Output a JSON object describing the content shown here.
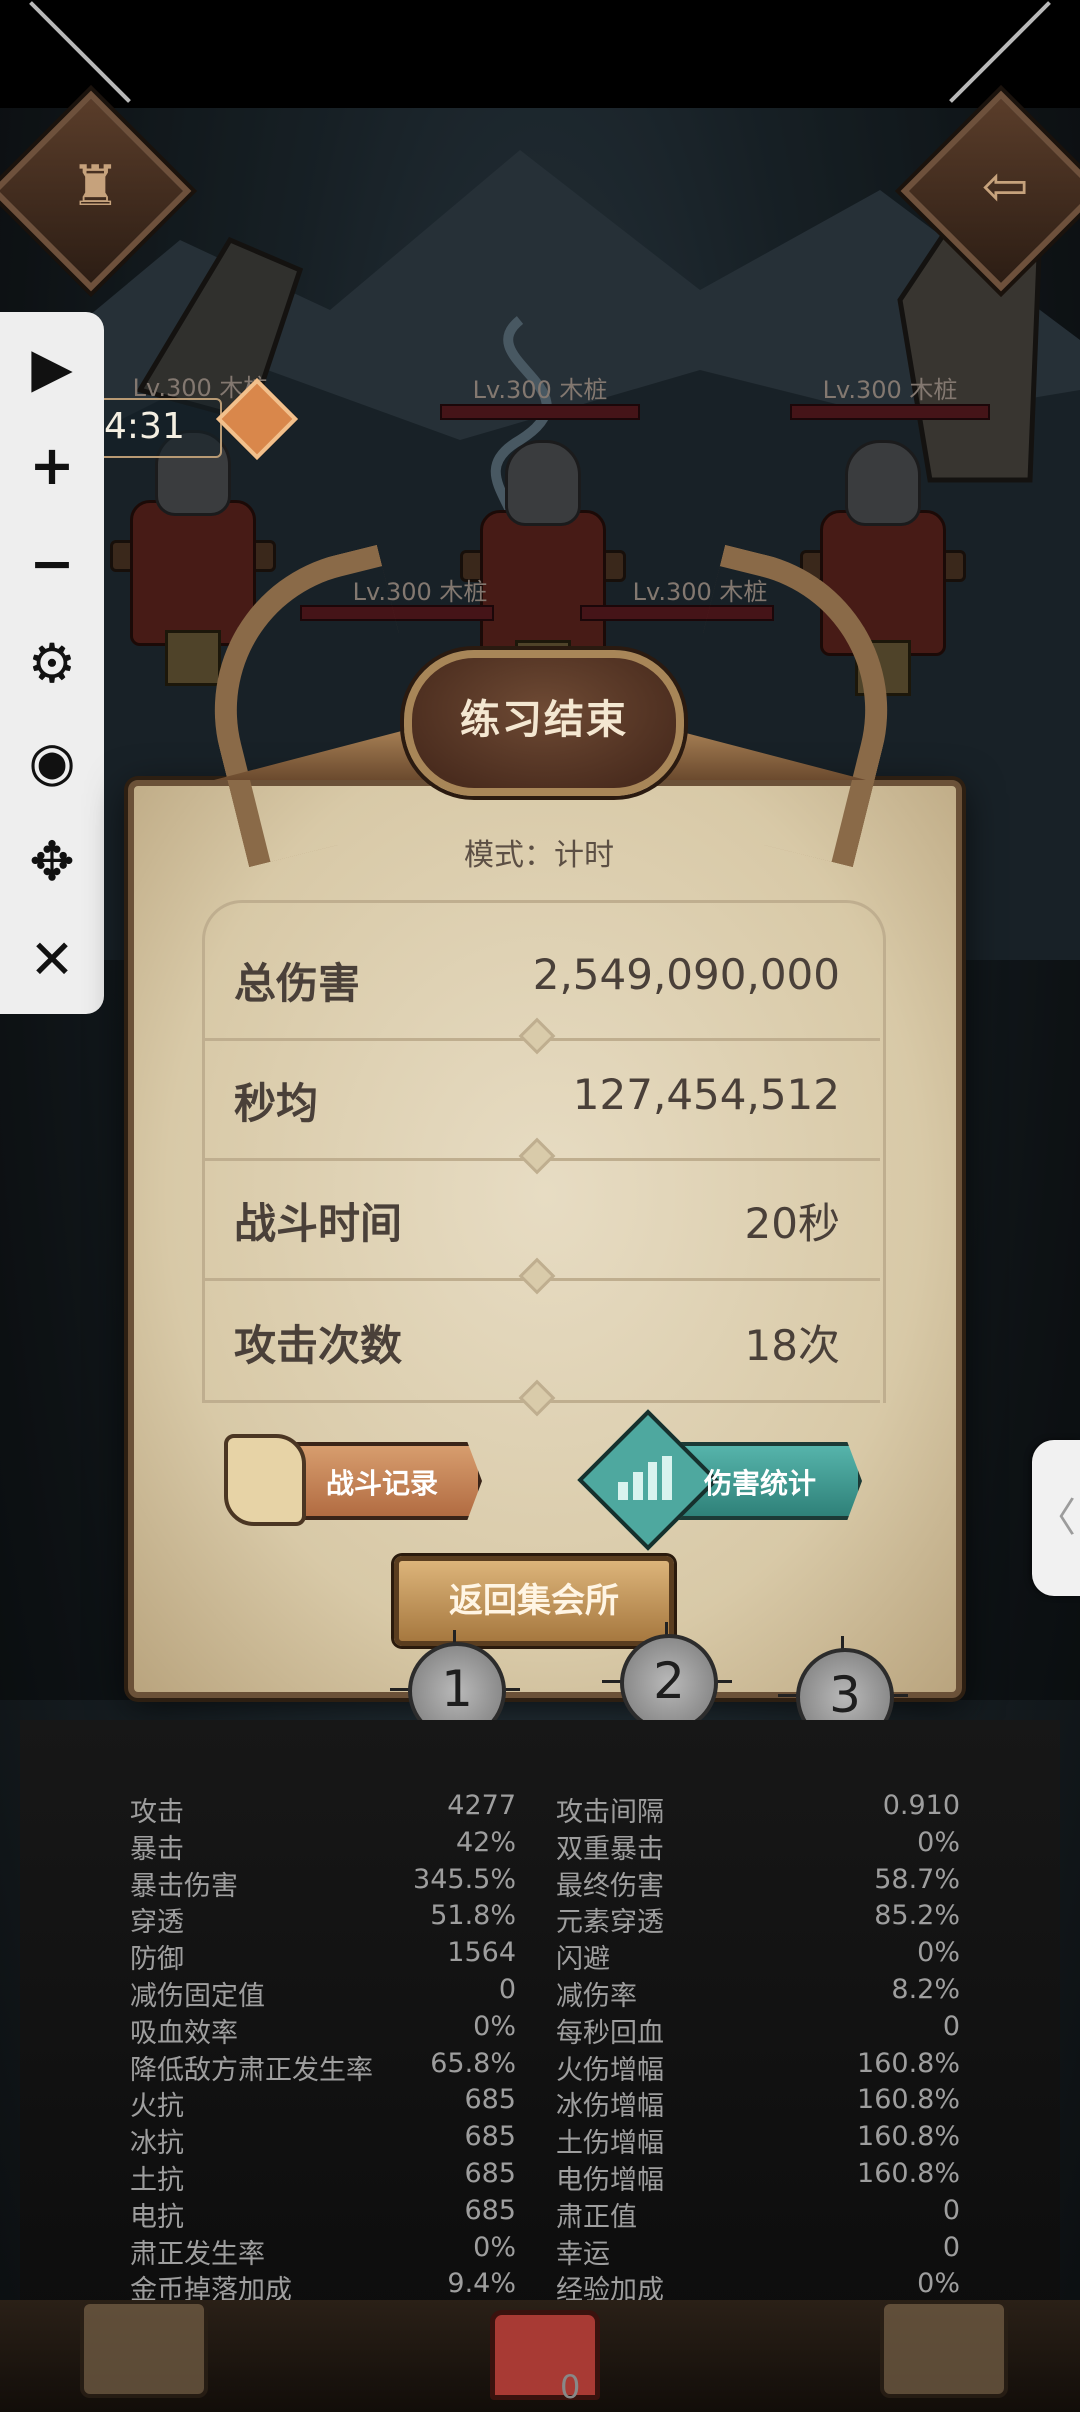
{
  "enemies": [
    {
      "label": "Lv.300 木桩"
    },
    {
      "label": "Lv.300 木桩"
    },
    {
      "label": "Lv.300 木桩"
    },
    {
      "label": "Lv.300 木桩"
    },
    {
      "label": "Lv.300 木桩"
    }
  ],
  "timer": {
    "time": "4:31"
  },
  "toolbar": {
    "play": "▶",
    "plus": "+",
    "minus": "−",
    "settings": "⚙",
    "hide": "◉",
    "move": "✥",
    "close": "✕"
  },
  "result": {
    "title": "练习结束",
    "mode": "模式：计时",
    "stats": [
      {
        "label": "总伤害",
        "value": "2,549,090,000"
      },
      {
        "label": "秒均",
        "value": "127,454,512"
      },
      {
        "label": "战斗时间",
        "value": "20秒"
      },
      {
        "label": "攻击次数",
        "value": "18次"
      }
    ],
    "battle_log_label": "战斗记录",
    "damage_stats_label": "伤害统计",
    "return_label": "返回集会所"
  },
  "targets": [
    {
      "label": "1"
    },
    {
      "label": "2"
    },
    {
      "label": "3"
    }
  ],
  "side_tab": {
    "arrow": "〈"
  },
  "attributes": {
    "left": [
      {
        "name": "攻击",
        "value": "4277"
      },
      {
        "name": "暴击",
        "value": "42%"
      },
      {
        "name": "暴击伤害",
        "value": "345.5%"
      },
      {
        "name": "穿透",
        "value": "51.8%"
      },
      {
        "name": "防御",
        "value": "1564"
      },
      {
        "name": "减伤固定值",
        "value": "0"
      },
      {
        "name": "吸血效率",
        "value": "0%"
      },
      {
        "name": "降低敌方肃正发生率",
        "value": "65.8%"
      },
      {
        "name": "火抗",
        "value": "685"
      },
      {
        "name": "冰抗",
        "value": "685"
      },
      {
        "name": "土抗",
        "value": "685"
      },
      {
        "name": "电抗",
        "value": "685"
      },
      {
        "name": "肃正发生率",
        "value": "0%"
      },
      {
        "name": "金币掉落加成",
        "value": "9.4%"
      }
    ],
    "right": [
      {
        "name": "攻击间隔",
        "value": "0.910"
      },
      {
        "name": "双重暴击",
        "value": "0%"
      },
      {
        "name": "最终伤害",
        "value": "58.7%"
      },
      {
        "name": "元素穿透",
        "value": "85.2%"
      },
      {
        "name": "闪避",
        "value": "0%"
      },
      {
        "name": "减伤率",
        "value": "8.2%"
      },
      {
        "name": "每秒回血",
        "value": "0"
      },
      {
        "name": "火伤增幅",
        "value": "160.8%"
      },
      {
        "name": "冰伤增幅",
        "value": "160.8%"
      },
      {
        "name": "土伤增幅",
        "value": "160.8%"
      },
      {
        "name": "电伤增幅",
        "value": "160.8%"
      },
      {
        "name": "肃正值",
        "value": "0"
      },
      {
        "name": "幸运",
        "value": "0"
      },
      {
        "name": "经验加成",
        "value": "0%"
      }
    ]
  },
  "bottom": {
    "chest_count": "0"
  }
}
